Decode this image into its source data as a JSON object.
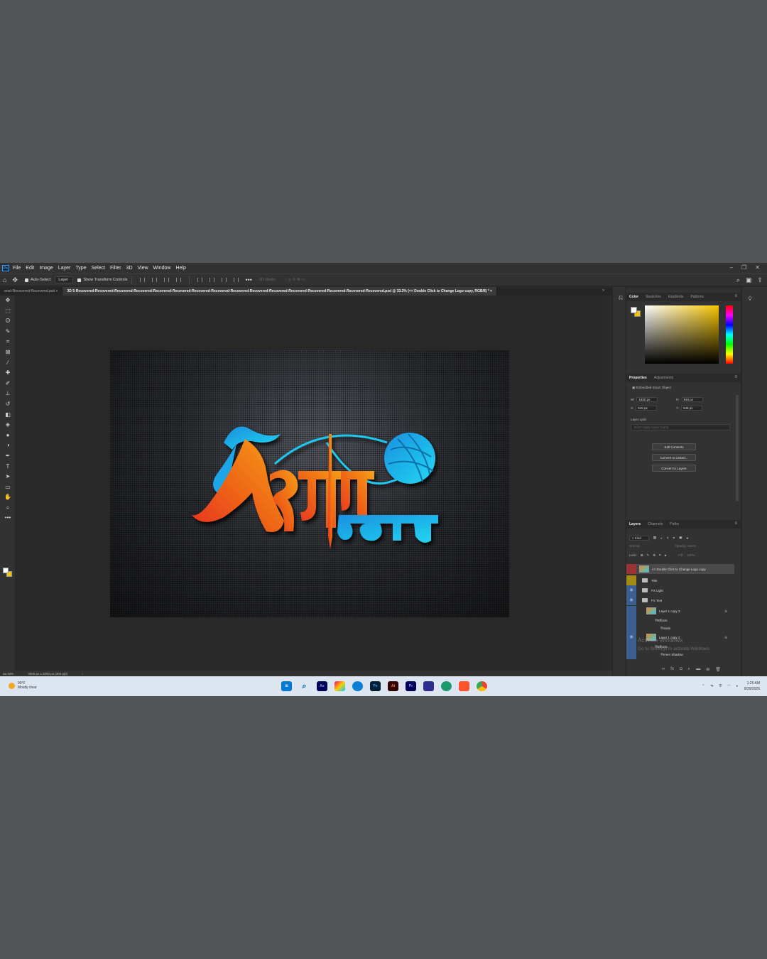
{
  "menubar": {
    "app_icon": "Ps",
    "items": [
      "File",
      "Edit",
      "Image",
      "Layer",
      "Type",
      "Select",
      "Filter",
      "3D",
      "View",
      "Window",
      "Help"
    ],
    "window_controls": [
      "–",
      "❐",
      "✕"
    ]
  },
  "options_bar": {
    "auto_select": "Auto-Select",
    "target": "Layer",
    "show_transform": "Show Transform Controls",
    "mode_3d": "3D Mode:"
  },
  "tabs": [
    {
      "label": "ered-Recovered-Recovered.psd",
      "close": "×"
    },
    {
      "label": "3D 5-Recovered-Recovered-Recovered-Recovered-Recovered-Recovered-Recovered-Recovered-Recovered-Recovered-Recovered-Recovered-Recovered-Recovered-Recovered-Recovered.psd @ 33.3% (<< Double Click to Change Logo copy, RGB/8) *",
      "close": "×"
    }
  ],
  "status": {
    "zoom": "33.33%",
    "doc_size": "3000 px x 2000 px (300 ppi)",
    "arrow": "›"
  },
  "color_panel": {
    "tabs": [
      "Color",
      "Swatches",
      "Gradients",
      "Patterns"
    ],
    "foreground": "#ffffff",
    "background": "#f5c400"
  },
  "properties": {
    "tabs": [
      "Properties",
      "Adjustments"
    ],
    "type": "Embedded Smart Object",
    "w_label": "W:",
    "w": "1830 px",
    "h_label": "H:",
    "h": "910 px",
    "x_label": "X:",
    "x": "615 px",
    "y_label": "Y:",
    "y": "545 px",
    "layer_comp_label": "Layer Lyxb",
    "layer_comp": "Don't Apply Layer Comp",
    "buttons": [
      "Edit Contents",
      "Convert to Linked...",
      "Convert to Layers"
    ]
  },
  "layers": {
    "tabs": [
      "Layers",
      "Channels",
      "Paths"
    ],
    "filter_kind": "Kind",
    "blend_mode": "Normal",
    "opacity_label": "Opacity:",
    "opacity": "100%",
    "lock_label": "Lock:",
    "fill_label": "Fill:",
    "fill": "100%",
    "rows": [
      {
        "name": "<< Double Click to Change Logo copy",
        "kind": "smart"
      },
      {
        "name": "Title",
        "kind": "folder"
      },
      {
        "name": "FX Light",
        "kind": "folder"
      },
      {
        "name": "FX Text",
        "kind": "folder"
      },
      {
        "name": "Layer 1 copy 3",
        "kind": "smart",
        "fx": "fx"
      },
      {
        "name": "Effects",
        "kind": "effect"
      },
      {
        "name": "Satin",
        "kind": "effect"
      },
      {
        "name": "Layer 1 copy 2",
        "kind": "smart",
        "fx": "fx"
      },
      {
        "name": "Effects",
        "kind": "effect"
      },
      {
        "name": "Inner Shadow",
        "kind": "effect"
      }
    ],
    "watermark_title": "Activate Windows",
    "watermark_sub": "Go to Settings to activate Windows."
  },
  "taskbar": {
    "temperature": "90°F",
    "weather": "Mostly clear",
    "apps": [
      "Ae",
      "Ps",
      "Ai",
      "Pr"
    ],
    "time": "1:25 AM",
    "date": "9/29/2026"
  },
  "colors": {
    "orange": "#f07a18",
    "red": "#e8321e",
    "cyan": "#1ed0f0",
    "blue": "#1a8fe0"
  }
}
